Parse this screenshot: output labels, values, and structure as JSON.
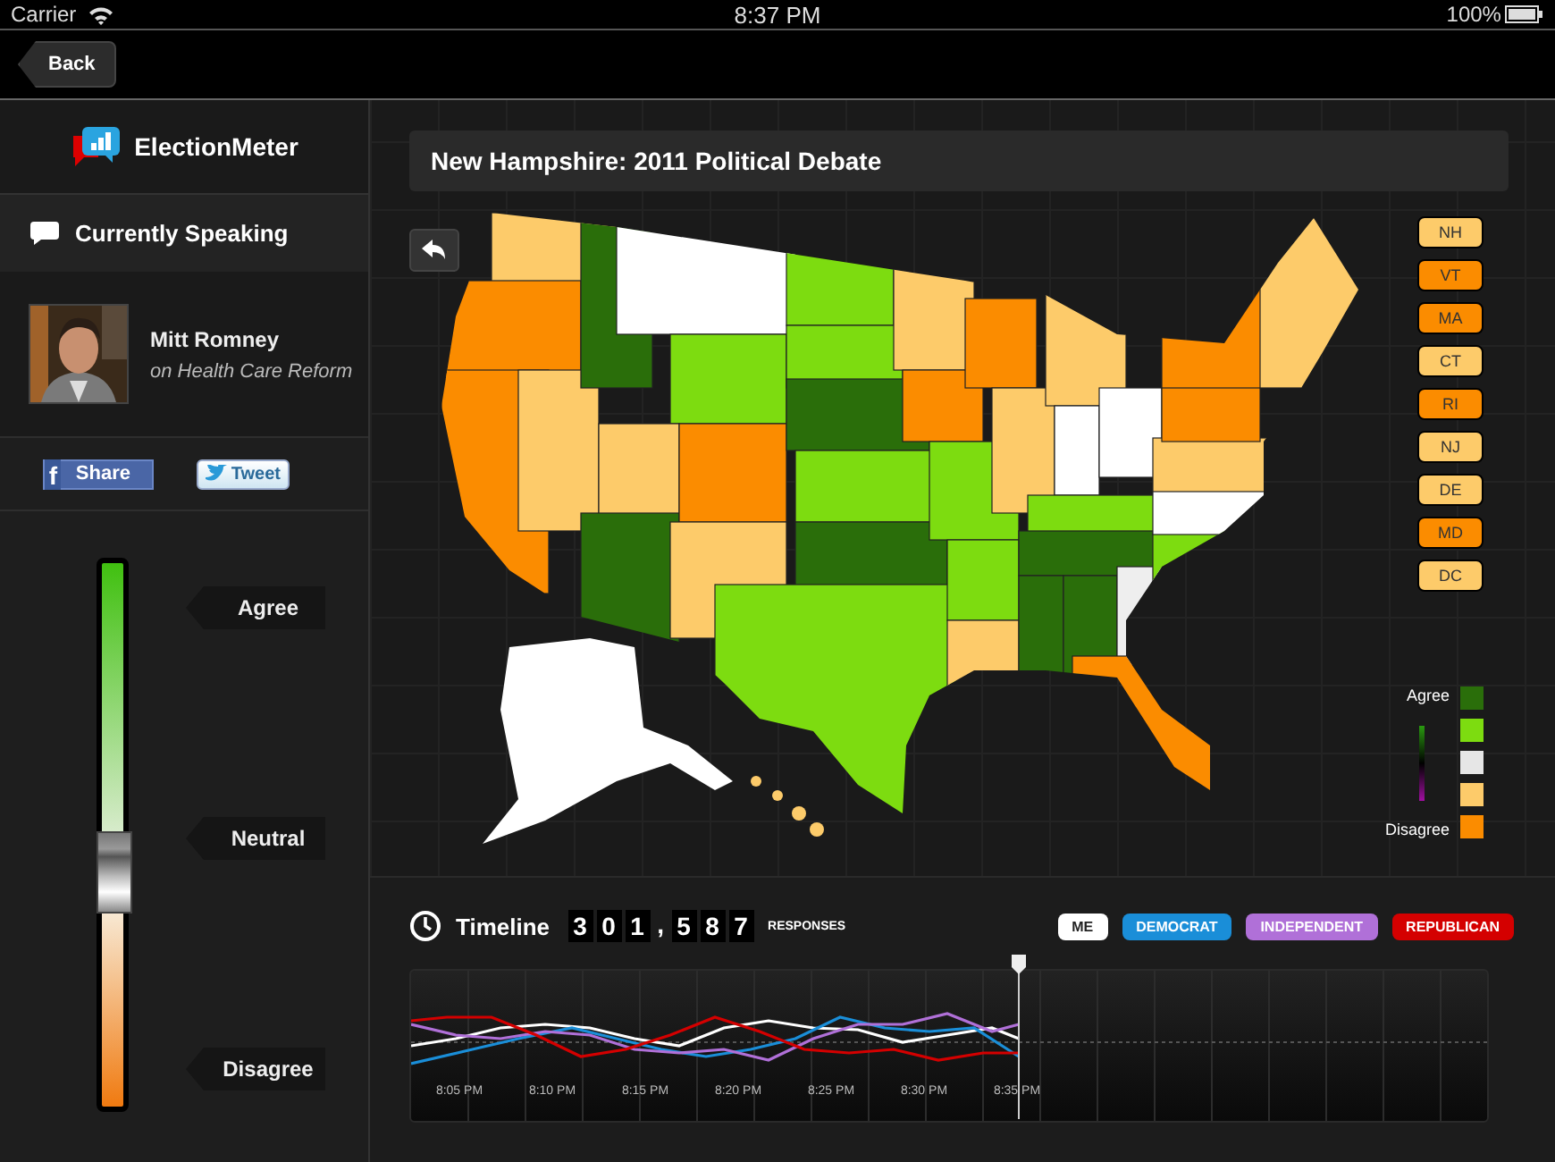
{
  "status_bar": {
    "carrier": "Carrier",
    "time": "8:37 PM",
    "battery": "100%"
  },
  "nav_bar": {
    "back_button": "Back"
  },
  "sidebar": {
    "app_name": "ElectionMeter",
    "section_title": "Currently Speaking",
    "speaker": {
      "name": "Mitt Romney",
      "topic": "on Health Care Reform"
    },
    "share_buttons": [
      {
        "kind": "facebook",
        "glyph": "f",
        "label": "Share"
      },
      {
        "kind": "twitter",
        "label": "Tweet"
      }
    ],
    "opinion_slider": {
      "level": 0.43,
      "labels": [
        "Agree",
        "Neutral",
        "Disagree"
      ]
    }
  },
  "debate_title": "New Hampshire: 2011 Political Debate",
  "state_buttons": [
    {
      "label": "NH",
      "color": "#fdcb6a"
    },
    {
      "label": "VT",
      "color": "#fb8c00"
    },
    {
      "label": "MA",
      "color": "#fb8c00"
    },
    {
      "label": "CT",
      "color": "#fdcb6a"
    },
    {
      "label": "RI",
      "color": "#fb8c00"
    },
    {
      "label": "NJ",
      "color": "#fdcb6a"
    },
    {
      "label": "DE",
      "color": "#fdcb6a"
    },
    {
      "label": "MD",
      "color": "#fb8c00"
    },
    {
      "label": "DC",
      "color": "#fdcb6a"
    }
  ],
  "legend": {
    "top_label": "Agree",
    "bottom_label": "Disagree",
    "swatches": [
      {
        "color": "#2a6e0a"
      },
      {
        "color": "#7ddc10"
      },
      {
        "color": "#e6e6e6"
      },
      {
        "color": "#fdcb6a"
      },
      {
        "color": "#fb8c00"
      }
    ]
  },
  "timeline": {
    "title": "Timeline",
    "counter_digits": [
      "3",
      "0",
      "1",
      ",",
      "5",
      "8",
      "7"
    ],
    "counter_caption": "RESPONSES",
    "filters": [
      {
        "label": "ME",
        "color": "#ffffff"
      },
      {
        "label": "DEMOCRAT",
        "color": "#1a8ed8"
      },
      {
        "label": "INDEPENDENT",
        "color": "#b070d8"
      },
      {
        "label": "REPUBLICAN",
        "color": "#d40000"
      }
    ],
    "time_labels": [
      "8:05 PM",
      "8:10 PM",
      "8:15 PM",
      "8:20 PM",
      "8:25 PM",
      "8:30 PM",
      "8:35 PM"
    ]
  }
}
